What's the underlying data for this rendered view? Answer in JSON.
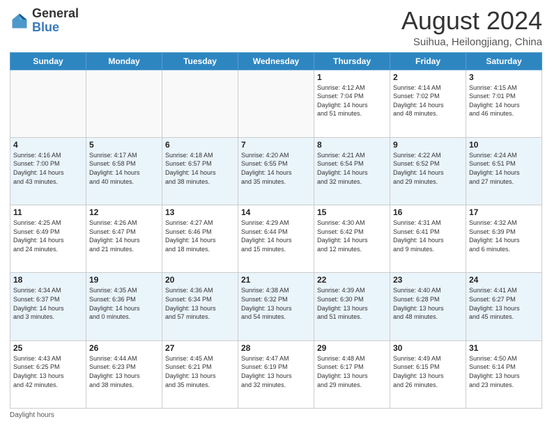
{
  "header": {
    "logo_general": "General",
    "logo_blue": "Blue",
    "month_title": "August 2024",
    "subtitle": "Suihua, Heilongjiang, China"
  },
  "days_of_week": [
    "Sunday",
    "Monday",
    "Tuesday",
    "Wednesday",
    "Thursday",
    "Friday",
    "Saturday"
  ],
  "footer": {
    "daylight_hours": "Daylight hours"
  },
  "weeks": [
    [
      {
        "day": "",
        "info": ""
      },
      {
        "day": "",
        "info": ""
      },
      {
        "day": "",
        "info": ""
      },
      {
        "day": "",
        "info": ""
      },
      {
        "day": "1",
        "info": "Sunrise: 4:12 AM\nSunset: 7:04 PM\nDaylight: 14 hours\nand 51 minutes."
      },
      {
        "day": "2",
        "info": "Sunrise: 4:14 AM\nSunset: 7:02 PM\nDaylight: 14 hours\nand 48 minutes."
      },
      {
        "day": "3",
        "info": "Sunrise: 4:15 AM\nSunset: 7:01 PM\nDaylight: 14 hours\nand 46 minutes."
      }
    ],
    [
      {
        "day": "4",
        "info": "Sunrise: 4:16 AM\nSunset: 7:00 PM\nDaylight: 14 hours\nand 43 minutes."
      },
      {
        "day": "5",
        "info": "Sunrise: 4:17 AM\nSunset: 6:58 PM\nDaylight: 14 hours\nand 40 minutes."
      },
      {
        "day": "6",
        "info": "Sunrise: 4:18 AM\nSunset: 6:57 PM\nDaylight: 14 hours\nand 38 minutes."
      },
      {
        "day": "7",
        "info": "Sunrise: 4:20 AM\nSunset: 6:55 PM\nDaylight: 14 hours\nand 35 minutes."
      },
      {
        "day": "8",
        "info": "Sunrise: 4:21 AM\nSunset: 6:54 PM\nDaylight: 14 hours\nand 32 minutes."
      },
      {
        "day": "9",
        "info": "Sunrise: 4:22 AM\nSunset: 6:52 PM\nDaylight: 14 hours\nand 29 minutes."
      },
      {
        "day": "10",
        "info": "Sunrise: 4:24 AM\nSunset: 6:51 PM\nDaylight: 14 hours\nand 27 minutes."
      }
    ],
    [
      {
        "day": "11",
        "info": "Sunrise: 4:25 AM\nSunset: 6:49 PM\nDaylight: 14 hours\nand 24 minutes."
      },
      {
        "day": "12",
        "info": "Sunrise: 4:26 AM\nSunset: 6:47 PM\nDaylight: 14 hours\nand 21 minutes."
      },
      {
        "day": "13",
        "info": "Sunrise: 4:27 AM\nSunset: 6:46 PM\nDaylight: 14 hours\nand 18 minutes."
      },
      {
        "day": "14",
        "info": "Sunrise: 4:29 AM\nSunset: 6:44 PM\nDaylight: 14 hours\nand 15 minutes."
      },
      {
        "day": "15",
        "info": "Sunrise: 4:30 AM\nSunset: 6:42 PM\nDaylight: 14 hours\nand 12 minutes."
      },
      {
        "day": "16",
        "info": "Sunrise: 4:31 AM\nSunset: 6:41 PM\nDaylight: 14 hours\nand 9 minutes."
      },
      {
        "day": "17",
        "info": "Sunrise: 4:32 AM\nSunset: 6:39 PM\nDaylight: 14 hours\nand 6 minutes."
      }
    ],
    [
      {
        "day": "18",
        "info": "Sunrise: 4:34 AM\nSunset: 6:37 PM\nDaylight: 14 hours\nand 3 minutes."
      },
      {
        "day": "19",
        "info": "Sunrise: 4:35 AM\nSunset: 6:36 PM\nDaylight: 14 hours\nand 0 minutes."
      },
      {
        "day": "20",
        "info": "Sunrise: 4:36 AM\nSunset: 6:34 PM\nDaylight: 13 hours\nand 57 minutes."
      },
      {
        "day": "21",
        "info": "Sunrise: 4:38 AM\nSunset: 6:32 PM\nDaylight: 13 hours\nand 54 minutes."
      },
      {
        "day": "22",
        "info": "Sunrise: 4:39 AM\nSunset: 6:30 PM\nDaylight: 13 hours\nand 51 minutes."
      },
      {
        "day": "23",
        "info": "Sunrise: 4:40 AM\nSunset: 6:28 PM\nDaylight: 13 hours\nand 48 minutes."
      },
      {
        "day": "24",
        "info": "Sunrise: 4:41 AM\nSunset: 6:27 PM\nDaylight: 13 hours\nand 45 minutes."
      }
    ],
    [
      {
        "day": "25",
        "info": "Sunrise: 4:43 AM\nSunset: 6:25 PM\nDaylight: 13 hours\nand 42 minutes."
      },
      {
        "day": "26",
        "info": "Sunrise: 4:44 AM\nSunset: 6:23 PM\nDaylight: 13 hours\nand 38 minutes."
      },
      {
        "day": "27",
        "info": "Sunrise: 4:45 AM\nSunset: 6:21 PM\nDaylight: 13 hours\nand 35 minutes."
      },
      {
        "day": "28",
        "info": "Sunrise: 4:47 AM\nSunset: 6:19 PM\nDaylight: 13 hours\nand 32 minutes."
      },
      {
        "day": "29",
        "info": "Sunrise: 4:48 AM\nSunset: 6:17 PM\nDaylight: 13 hours\nand 29 minutes."
      },
      {
        "day": "30",
        "info": "Sunrise: 4:49 AM\nSunset: 6:15 PM\nDaylight: 13 hours\nand 26 minutes."
      },
      {
        "day": "31",
        "info": "Sunrise: 4:50 AM\nSunset: 6:14 PM\nDaylight: 13 hours\nand 23 minutes."
      }
    ]
  ]
}
